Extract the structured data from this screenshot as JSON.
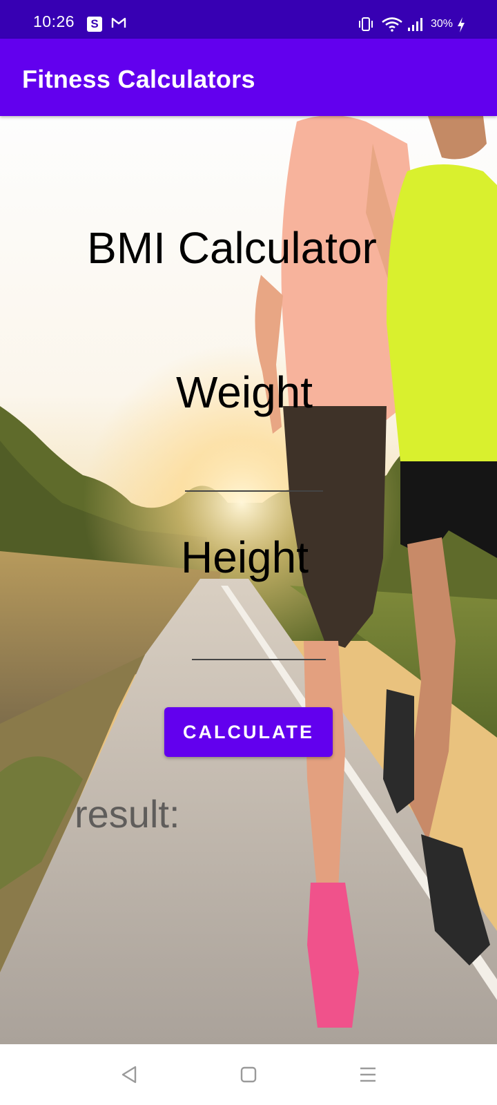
{
  "status_bar": {
    "time": "10:26",
    "notification_letter": "S",
    "battery": "30%",
    "icons": [
      "s-app-icon",
      "gmail-icon",
      "vibrate-icon",
      "wifi-icon",
      "signal-icon",
      "charging-bolt-icon"
    ]
  },
  "app_bar": {
    "title": "Fitness Calculators",
    "color": "#6200ee"
  },
  "main": {
    "title": "BMI Calculator",
    "weight_label": "Weight",
    "weight_value": "",
    "height_label": "Height",
    "height_value": "",
    "calculate_label": "CALCULATE",
    "result_label": "result:",
    "background_image": "running couple on road at sunset"
  },
  "nav_bar": {
    "icons": [
      "back-icon",
      "home-icon",
      "recents-icon"
    ]
  },
  "colors": {
    "status_bar": "#3700b3",
    "accent": "#6200ee"
  }
}
